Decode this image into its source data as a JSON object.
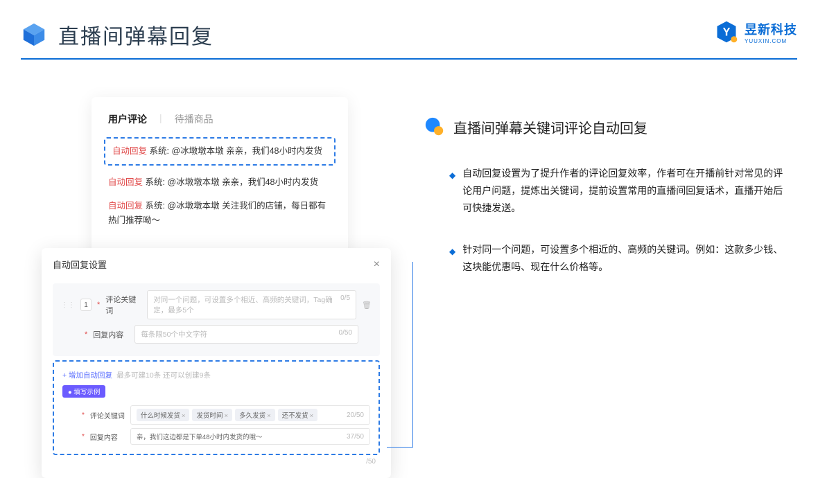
{
  "header": {
    "title": "直播间弹幕回复",
    "brand_name": "昱新科技",
    "brand_sub": "YUUXIN.COM"
  },
  "comments_card": {
    "tab_active": "用户评论",
    "tab_other": "待播商品",
    "row1_tag": "自动回复",
    "row1_text": "系统: @冰墩墩本墩 亲亲，我们48小时内发货",
    "row2_tag": "自动回复",
    "row2_text": "系统: @冰墩墩本墩 亲亲，我们48小时内发货",
    "row3_tag": "自动回复",
    "row3_text": "系统: @冰墩墩本墩 关注我们的店铺，每日都有热门推荐呦～"
  },
  "settings": {
    "title": "自动回复设置",
    "idx": "1",
    "kw_label": "评论关键词",
    "kw_placeholder": "对同一个问题，可设置多个相近、高频的关键词，Tag确定，最多5个",
    "kw_count": "0/5",
    "content_label": "回复内容",
    "content_placeholder": "每条限50个中文字符",
    "content_count": "0/50",
    "add_link": "+ 增加自动回复",
    "add_hint": "最多可建10条 还可以创建9条",
    "example_badge": "● 填写示例",
    "ex_kw_label": "评论关键词",
    "chips": [
      "什么时候发货",
      "发货时间",
      "多久发货",
      "还不发货"
    ],
    "ex_kw_count": "20/50",
    "ex_content_label": "回复内容",
    "ex_content_value": "亲，我们这边都是下单48小时内发货的哦～",
    "ex_content_count": "37/50",
    "outer_count": "/50"
  },
  "right": {
    "section_title": "直播间弹幕关键词评论自动回复",
    "bullet1": "自动回复设置为了提升作者的评论回复效率，作者可在开播前针对常见的评论用户问题，提炼出关键词，提前设置常用的直播间回复话术，直播开始后可快捷发送。",
    "bullet2": "针对同一个问题，可设置多个相近的、高频的关键词。例如：这款多少钱、这块能优惠吗、现在什么价格等。"
  }
}
